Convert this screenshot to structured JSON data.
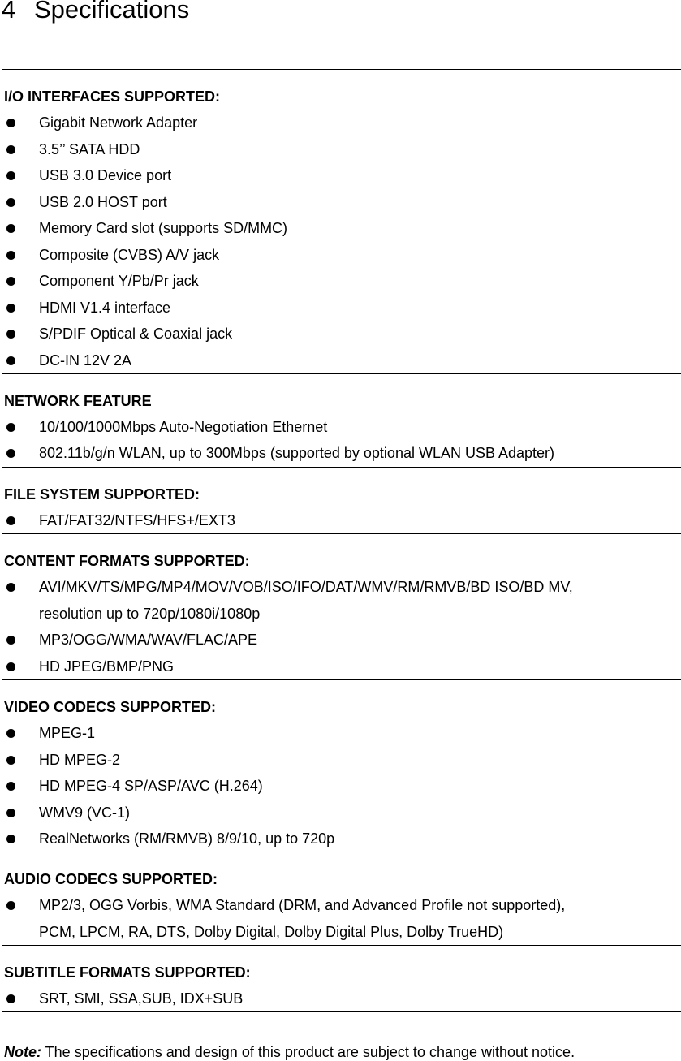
{
  "page": {
    "section_number": "4",
    "section_title": "Specifications"
  },
  "sections": [
    {
      "heading": "I/O INTERFACES SUPPORTED:",
      "items": [
        "Gigabit Network Adapter",
        "3.5’’ SATA HDD",
        "USB 3.0 Device port",
        "USB 2.0 HOST port",
        "Memory Card slot (supports SD/MMC)",
        "Composite (CVBS) A/V jack",
        "Component Y/Pb/Pr jack",
        "HDMI V1.4 interface",
        "S/PDIF Optical & Coaxial jack",
        "DC-IN 12V 2A"
      ]
    },
    {
      "heading": "NETWORK FEATURE",
      "items": [
        "10/100/1000Mbps Auto-Negotiation Ethernet",
        "802.11b/g/n WLAN, up to 300Mbps (supported by optional WLAN USB Adapter)"
      ]
    },
    {
      "heading": "FILE SYSTEM SUPPORTED:",
      "items": [
        "FAT/FAT32/NTFS/HFS+/EXT3"
      ]
    },
    {
      "heading": "CONTENT FORMATS SUPPORTED:",
      "items": [
        "AVI/MKV/TS/MPG/MP4/MOV/VOB/ISO/IFO/DAT/WMV/RM/RMVB/BD ISO/BD MV,",
        "resolution up to 720p/1080i/1080p",
        "MP3/OGG/WMA/WAV/FLAC/APE",
        "HD JPEG/BMP/PNG"
      ]
    },
    {
      "heading": "VIDEO CODECS SUPPORTED:",
      "items": [
        "MPEG-1",
        "HD MPEG-2",
        "HD MPEG-4 SP/ASP/AVC (H.264)",
        "WMV9 (VC-1)",
        "RealNetworks (RM/RMVB) 8/9/10, up to 720p"
      ]
    },
    {
      "heading": "AUDIO CODECS SUPPORTED:",
      "items": [
        "MP2/3, OGG Vorbis, WMA Standard (DRM, and Advanced Profile not supported),",
        "PCM, LPCM, RA, DTS, Dolby Digital, Dolby Digital Plus, Dolby TrueHD)"
      ]
    },
    {
      "heading": "SUBTITLE FORMATS SUPPORTED:",
      "items": [
        "SRT, SMI, SSA,SUB, IDX+SUB"
      ]
    }
  ],
  "note": {
    "label": "Note:",
    "text": " The specifications and design of this product are subject to change without notice."
  }
}
